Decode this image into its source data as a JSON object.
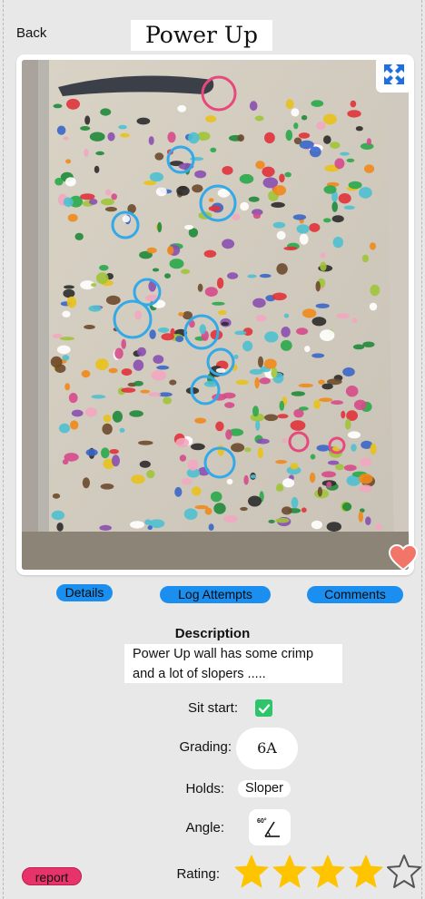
{
  "header": {
    "back_label": "Back",
    "title": "Power Up"
  },
  "media": {
    "photo_alt": "Climbing wall with highlighted holds"
  },
  "tabs": [
    {
      "label": "Details"
    },
    {
      "label": "Log Attempts"
    },
    {
      "label": "Comments"
    }
  ],
  "description": {
    "heading": "Description",
    "line1": "Power Up wall has some crimp",
    "line2": "and a lot of slopers ....."
  },
  "attributes": {
    "sit_start_label": "Sit start:",
    "sit_start_checked": true,
    "grading_label": "Grading:",
    "grade": "6A",
    "holds_label": "Holds:",
    "holds": "Sloper",
    "angle_label": "Angle:",
    "angle_icon_text": "60°",
    "rating_label": "Rating:",
    "rating": 4,
    "rating_max": 5
  },
  "actions": {
    "report_label": "report",
    "favorite": true
  },
  "colors": {
    "accent_blue": "#1a8ff0",
    "report_pink": "#e8336a",
    "heart": "#f2756a",
    "star": "#ffc400",
    "check_green": "#2ec46a",
    "ring_blue": "#33a9e8",
    "ring_pink": "#e8497d"
  }
}
